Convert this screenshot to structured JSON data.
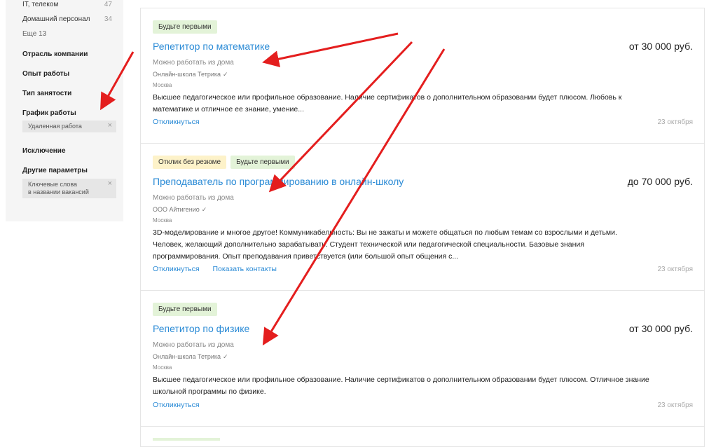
{
  "sidebar": {
    "industry_items": [
      {
        "label": "IT, телеком",
        "count": "47"
      },
      {
        "label": "Домашний персонал",
        "count": "34"
      }
    ],
    "more": "Еще 13",
    "sections": {
      "company_industry": "Отрасль компании",
      "experience": "Опыт работы",
      "employment_type": "Тип занятости",
      "schedule": "График работы",
      "exclusion": "Исключение",
      "other": "Другие параметры"
    },
    "schedule_tag": "Удаленная работа",
    "keywords_tag_line1": "Ключевые слова",
    "keywords_tag_line2": "в названии вакансий",
    "close_glyph": "×"
  },
  "vacancies": [
    {
      "badges": [
        "Будьте первыми"
      ],
      "title": "Репетитор по математике",
      "salary": "от 30 000 руб.",
      "remote": "Можно работать из дома",
      "company": "Онлайн-школа Тетрика",
      "city": "Москва",
      "desc_line1": "Высшее педагогическое или профильное образование. Наличие сертификатов о дополнительном образовании будет плюсом. Любовь к",
      "desc_line2": "математике и отличное ее знание, умение...",
      "actions": [
        "Откликнуться"
      ],
      "date": "23 октября"
    },
    {
      "badges": [
        "Отклик без резюме",
        "Будьте первыми"
      ],
      "title": "Преподаватель по программированию в онлайн-школу",
      "salary": "до 70 000 руб.",
      "remote": "Можно работать из дома",
      "company": "ООО Айтигенио",
      "city": "Москва",
      "desc_line1": "3D-моделирование и многое другое! Коммуникабельность: Вы не зажаты и можете общаться по любым темам со взрослыми и детьми.",
      "desc_line2": "Человек, желающий дополнительно зарабатывать. Студент технической или педагогической специальности. Базовые знания",
      "desc_line3": "программирования. Опыт преподавания приветствуется (или большой опыт общения с...",
      "actions": [
        "Откликнуться",
        "Показать контакты"
      ],
      "date": "23 октября"
    },
    {
      "badges": [
        "Будьте первыми"
      ],
      "title": "Репетитор по физике",
      "salary": "от 30 000 руб.",
      "remote": "Можно работать из дома",
      "company": "Онлайн-школа Тетрика",
      "city": "Москва",
      "desc_line1": "Высшее педагогическое или профильное образование. Наличие сертификатов о дополнительном образовании будет плюсом. Отличное знание",
      "desc_line2": "школьной программы по физике.",
      "actions": [
        "Откликнуться"
      ],
      "date": "23 октября"
    }
  ],
  "colors": {
    "link": "#2b8bd6",
    "badge_green": "#e3f3d8",
    "badge_yellow": "#fdf2c9",
    "arrow": "#e41e1e"
  },
  "icons": {
    "verified": "check-icon",
    "remove_filter": "close-icon"
  }
}
